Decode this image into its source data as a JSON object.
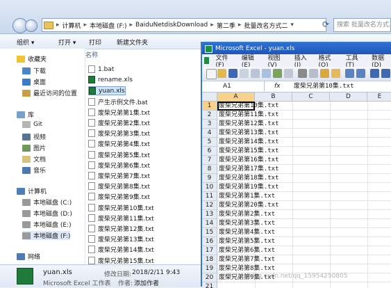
{
  "explorer": {
    "breadcrumb": [
      "计算机",
      "本地磁盘 (F:)",
      "BaiduNetdiskDownload",
      "第二季",
      "批量改名方式二"
    ],
    "search_placeholder": "搜索 批量改名方式二",
    "toolbar": [
      "组织 ▾",
      "打开 ▾",
      "打印",
      "新建文件夹"
    ],
    "nav": {
      "favorites": [
        "收藏夹",
        "下载",
        "桌面",
        "最近访问的位置"
      ],
      "libraries": [
        "库",
        "Git",
        "视频",
        "图片",
        "文档",
        "音乐"
      ],
      "computer": [
        "计算机",
        "本地磁盘 (C:)",
        "本地磁盘 (D:)",
        "本地磁盘 (E:)",
        "本地磁盘 (F:)"
      ],
      "network": "网络"
    },
    "column_header": "名称",
    "files": [
      "1.bat",
      "rename.xls",
      "yuan.xls",
      "产生示例文件.bat",
      "废柴兄弟第1集.txt",
      "废柴兄弟第2集.txt",
      "废柴兄弟第3集.txt",
      "废柴兄弟第4集.txt",
      "废柴兄弟第5集.txt",
      "废柴兄弟第6集.txt",
      "废柴兄弟第7集.txt",
      "废柴兄弟第8集.txt",
      "废柴兄弟第9集.txt",
      "废柴兄弟第10集.txt",
      "废柴兄弟第11集.txt",
      "废柴兄弟第12集.txt",
      "废柴兄弟第13集.txt",
      "废柴兄弟第14集.txt",
      "废柴兄弟第15集.txt",
      "废柴兄弟第16集.txt"
    ],
    "details": {
      "name": "yuan.xls",
      "type": "Microsoft Excel 工作表",
      "modified_label": "修改日期:",
      "modified_value": "2018/2/11 9:43",
      "author_label": "作者:",
      "author_value": "添加作者"
    }
  },
  "excel": {
    "title": "Microsoft Excel - yuan.xls",
    "menu": [
      "文件(F)",
      "编辑(E)",
      "视图(V)",
      "插入(I)",
      "格式(O)",
      "工具(T)",
      "数据(D)"
    ],
    "name_box": "A1",
    "fx": "fx",
    "formula": "废柴兄弟第10集.txt",
    "columns": [
      "A",
      "B",
      "C",
      "D",
      "E"
    ],
    "rows": [
      "1",
      "2",
      "3",
      "4",
      "5",
      "6",
      "7",
      "8",
      "9",
      "10",
      "11",
      "12",
      "13",
      "14",
      "15",
      "16",
      "17",
      "18",
      "19",
      "20",
      "21"
    ],
    "cells": [
      "废柴兄弟第10集.txt",
      "废柴兄弟第11集.txt",
      "废柴兄弟第12集.txt",
      "废柴兄弟第13集.txt",
      "废柴兄弟第14集.txt",
      "废柴兄弟第15集.txt",
      "废柴兄弟第16集.txt",
      "废柴兄弟第17集.txt",
      "废柴兄弟第18集.txt",
      "废柴兄弟第19集.txt",
      "废柴兄弟第1集.txt",
      "废柴兄弟第20集.txt",
      "废柴兄弟第2集.txt",
      "废柴兄弟第3集.txt",
      "废柴兄弟第4集.txt",
      "废柴兄弟第5集.txt",
      "废柴兄弟第6集.txt",
      "废柴兄弟第7集.txt",
      "废柴兄弟第8集.txt",
      "废柴兄弟第9集.txt",
      ""
    ]
  },
  "watermark": "http://blog.csdn.net/qq_15954250805"
}
